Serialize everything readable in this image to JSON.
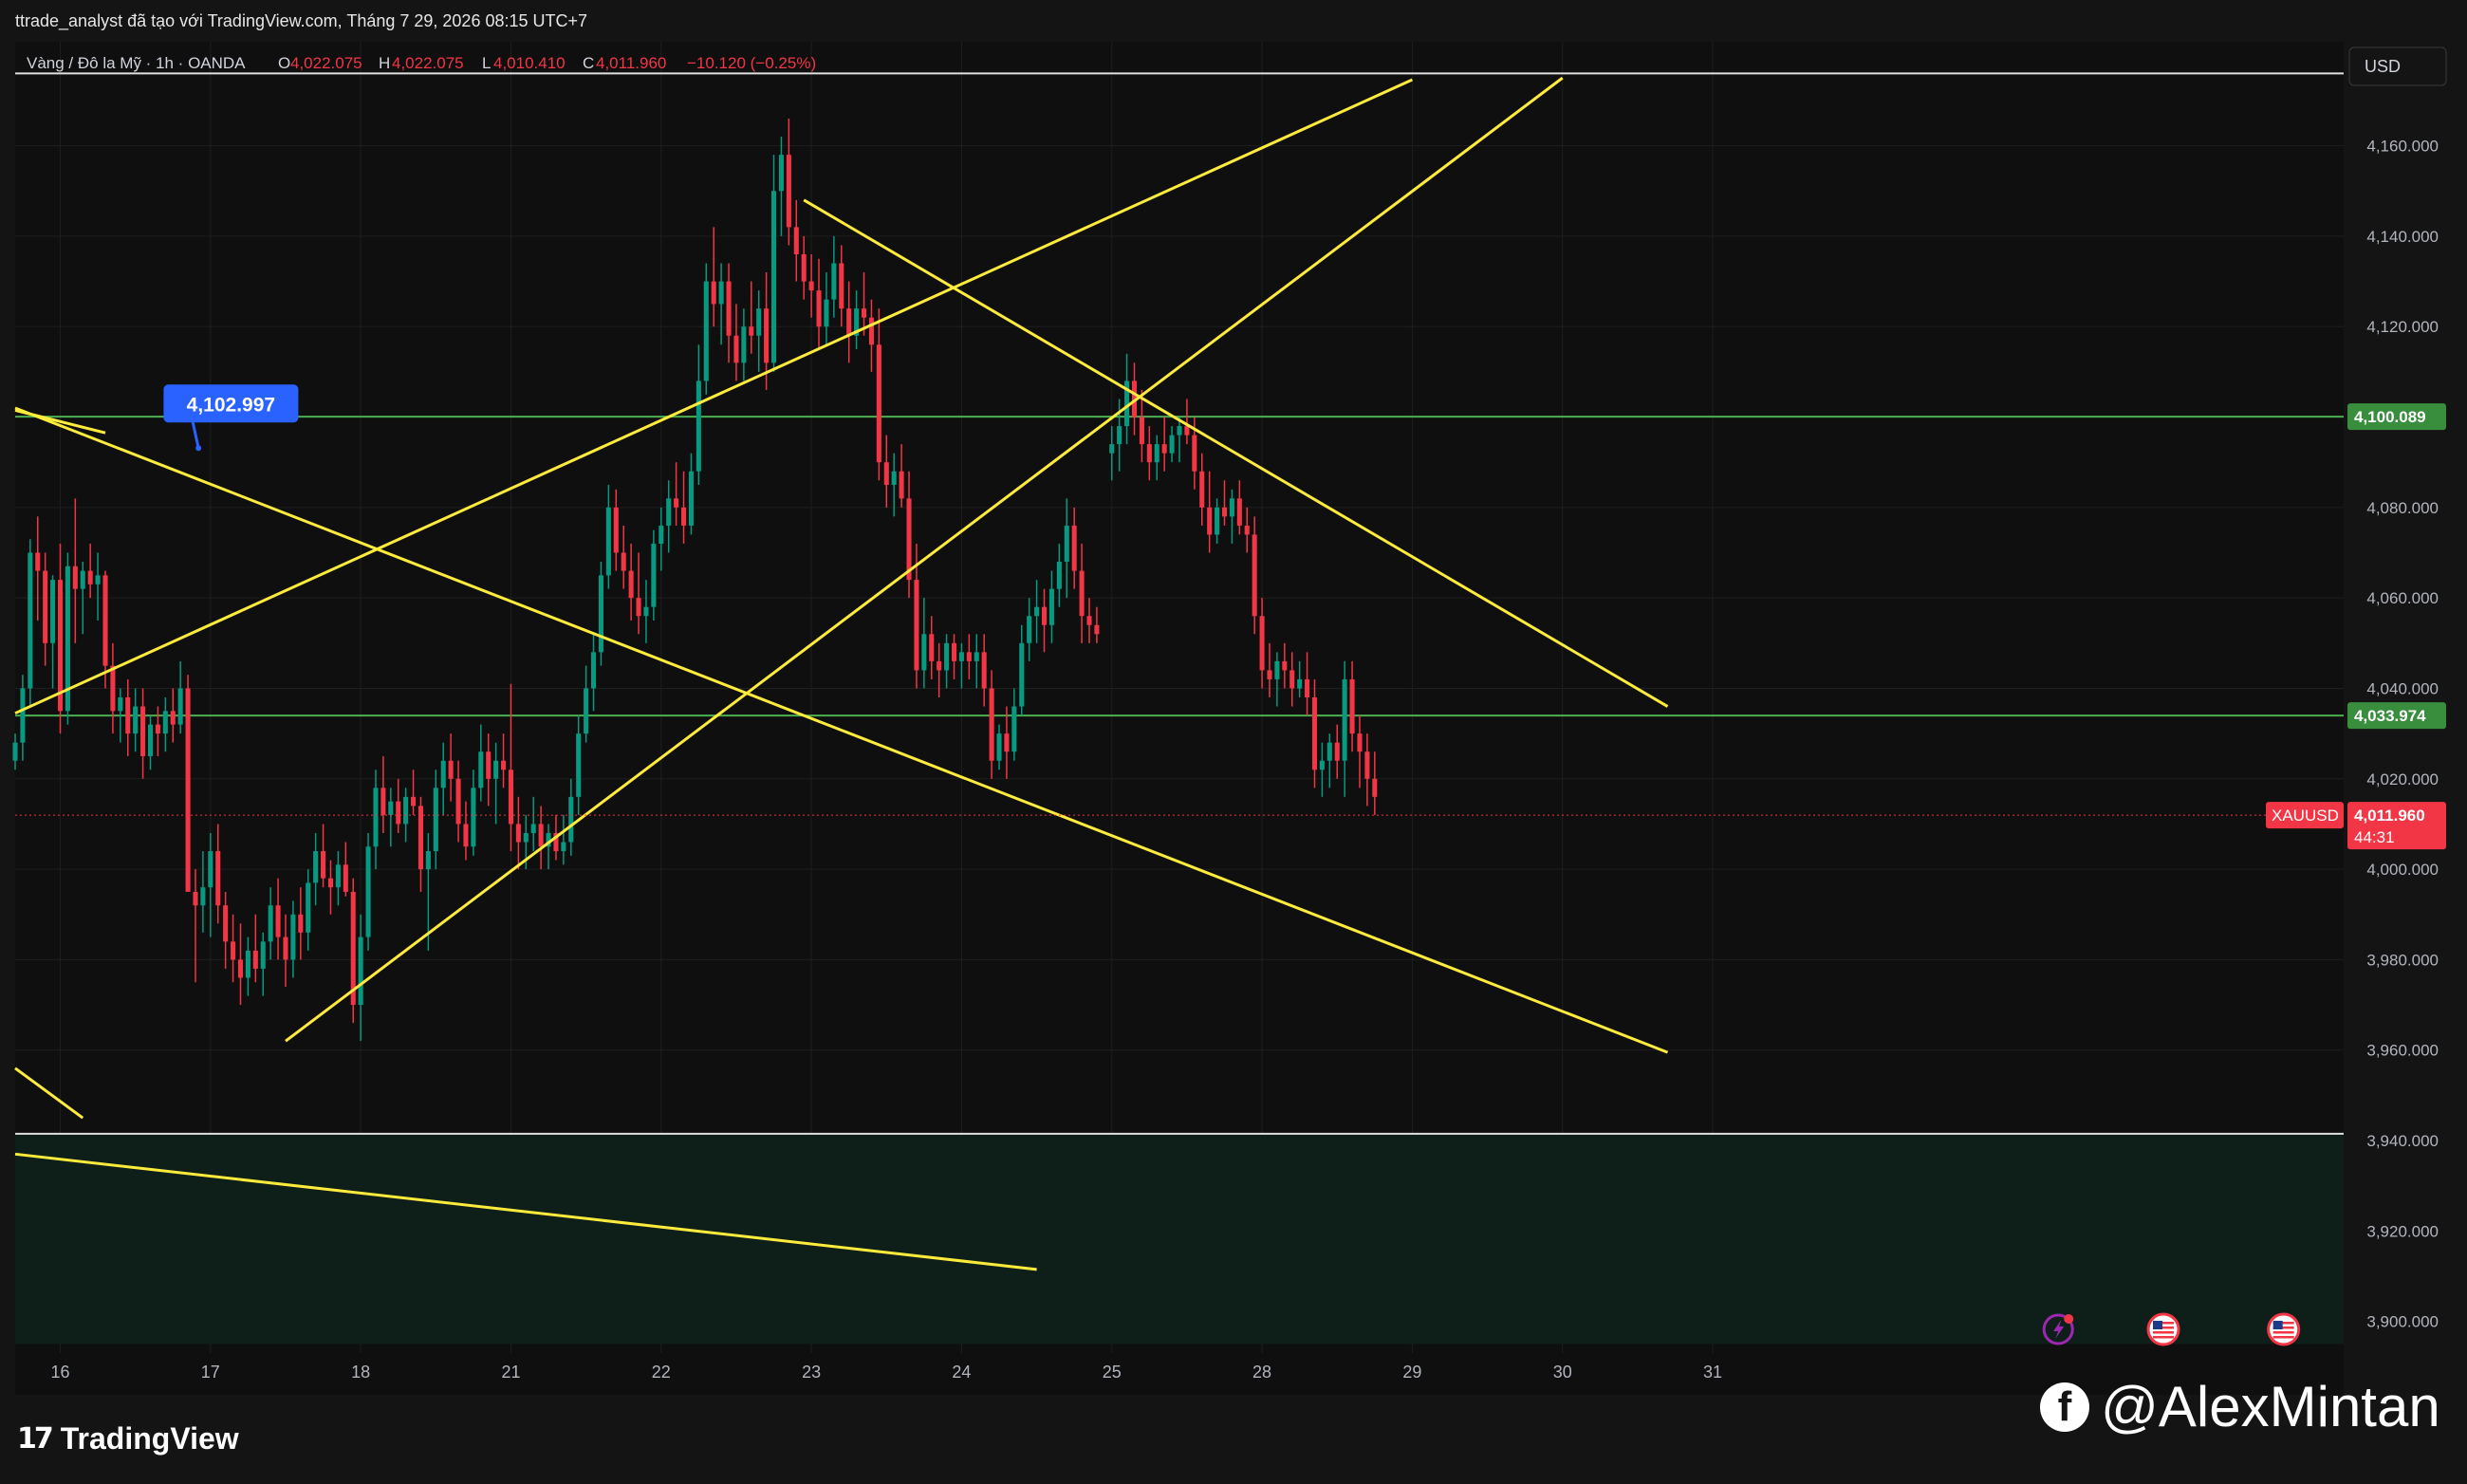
{
  "header": {
    "attribution": "ttrade_analyst đã tạo với TradingView.com, Tháng 7 29, 2026 08:15 UTC+7"
  },
  "legend": {
    "symbol": "Vàng / Đô la Mỹ · 1h · OANDA",
    "o_label": "O",
    "o_value": "4,022.075",
    "h_label": "H",
    "h_value": "4,022.075",
    "l_label": "L",
    "l_value": "4,010.410",
    "c_label": "C",
    "c_value": "4,011.960",
    "change": "−10.120 (−0.25%)"
  },
  "currency_label": "USD",
  "footer": {
    "brand": "TradingView"
  },
  "watermark": {
    "handle": "@AlexMintan"
  },
  "colors": {
    "background": "#0f0f0f",
    "up_candle": "#089981",
    "down_candle": "#f23645",
    "trendline": "#ffeb3b",
    "horizontal_level": "#4caf50",
    "callout": "#2962ff",
    "zone_fill": "#0e1f1a"
  },
  "callout": {
    "value": "4,102.997",
    "price": 4102.997
  },
  "price_badges": [
    {
      "price": 4100.089,
      "label": "4,100.089",
      "color": "#388e3c"
    },
    {
      "price": 4033.974,
      "label": "4,033.974",
      "color": "#388e3c"
    }
  ],
  "last_price": {
    "symbol": "XAUUSD",
    "price": 4011.96,
    "label": "4,011.960",
    "countdown": "44:31"
  },
  "horizontal_lines": [
    {
      "price": 4100.089,
      "color": "#4caf50"
    },
    {
      "price": 4033.974,
      "color": "#4caf50"
    },
    {
      "price": 4176.0,
      "color": "#e0e0e0"
    },
    {
      "price": 3941.5,
      "color": "#e0e0e0"
    }
  ],
  "zone": {
    "from_price": 3941.5,
    "to_price": 3895.0
  },
  "event_icons": [
    {
      "name": "lightning-event-icon",
      "x": 29.3
    },
    {
      "name": "us-flag-event-icon",
      "x": 30.0
    },
    {
      "name": "us-flag-event-icon",
      "x": 30.8
    }
  ],
  "chart_data": {
    "type": "candlestick",
    "title": "Vàng / Đô la Mỹ · 1h · OANDA",
    "x_axis": {
      "range": [
        15.7,
        31.2
      ],
      "ticks": [
        {
          "x": 16,
          "label": "16"
        },
        {
          "x": 17,
          "label": "17"
        },
        {
          "x": 18,
          "label": "18"
        },
        {
          "x": 19,
          "label": "21"
        },
        {
          "x": 20,
          "label": "22"
        },
        {
          "x": 21,
          "label": "23"
        },
        {
          "x": 22,
          "label": "24"
        },
        {
          "x": 23,
          "label": "25"
        },
        {
          "x": 24,
          "label": "28"
        },
        {
          "x": 25,
          "label": "29"
        },
        {
          "x": 26,
          "label": "30"
        },
        {
          "x": 27,
          "label": "31"
        }
      ]
    },
    "y_axis": {
      "range": [
        3893,
        4183
      ],
      "ticks": [
        3900,
        3920,
        3940,
        3960,
        3980,
        4000,
        4020,
        4040,
        4060,
        4080,
        4100,
        4120,
        4140,
        4160
      ],
      "tick_labels": [
        "3,900.000",
        "3,920.000",
        "3,940.000",
        "3,960.000",
        "3,980.000",
        "4,000.000",
        "4,020.000",
        "4,040.000",
        "4,060.000",
        "4,080.000",
        "4,100.000",
        "4,120.000",
        "4,140.000",
        "4,160.000"
      ]
    },
    "grid": true,
    "candles": [
      [
        15.7,
        4024,
        4030,
        4022,
        4028
      ],
      [
        15.75,
        4028,
        4043,
        4024,
        4040
      ],
      [
        15.8,
        4040,
        4073,
        4036,
        4070
      ],
      [
        15.85,
        4070,
        4078,
        4055,
        4066
      ],
      [
        15.9,
        4066,
        4070,
        4045,
        4050
      ],
      [
        15.95,
        4050,
        4065,
        4040,
        4064
      ],
      [
        16.0,
        4064,
        4072,
        4030,
        4035
      ],
      [
        16.05,
        4035,
        4070,
        4032,
        4067
      ],
      [
        16.1,
        4067,
        4082,
        4050,
        4062
      ],
      [
        16.15,
        4062,
        4068,
        4052,
        4066
      ],
      [
        16.2,
        4066,
        4072,
        4060,
        4063
      ],
      [
        16.25,
        4063,
        4070,
        4055,
        4065
      ],
      [
        16.3,
        4065,
        4066,
        4040,
        4045
      ],
      [
        16.35,
        4045,
        4050,
        4030,
        4035
      ],
      [
        16.4,
        4035,
        4040,
        4028,
        4038
      ],
      [
        16.45,
        4038,
        4042,
        4025,
        4030
      ],
      [
        16.5,
        4030,
        4040,
        4026,
        4036
      ],
      [
        16.55,
        4036,
        4040,
        4020,
        4025
      ],
      [
        16.6,
        4025,
        4034,
        4022,
        4032
      ],
      [
        16.65,
        4032,
        4036,
        4025,
        4030
      ],
      [
        16.7,
        4030,
        4038,
        4026,
        4035
      ],
      [
        16.75,
        4035,
        4040,
        4028,
        4032
      ],
      [
        16.8,
        4032,
        4046,
        4030,
        4040
      ],
      [
        16.85,
        4040,
        4043,
        4000,
        3995
      ],
      [
        16.9,
        3995,
        4000,
        3975,
        3992
      ],
      [
        16.95,
        3992,
        4004,
        3986,
        3996
      ],
      [
        17.0,
        3996,
        4008,
        3985,
        4004
      ],
      [
        17.05,
        4004,
        4010,
        3988,
        3992
      ],
      [
        17.1,
        3992,
        3995,
        3978,
        3984
      ],
      [
        17.15,
        3984,
        3990,
        3975,
        3980
      ],
      [
        17.2,
        3980,
        3988,
        3970,
        3976
      ],
      [
        17.25,
        3976,
        3985,
        3972,
        3982
      ],
      [
        17.3,
        3982,
        3990,
        3975,
        3978
      ],
      [
        17.35,
        3978,
        3986,
        3972,
        3984
      ],
      [
        17.4,
        3984,
        3996,
        3980,
        3992
      ],
      [
        17.45,
        3992,
        3998,
        3980,
        3985
      ],
      [
        17.5,
        3985,
        3990,
        3974,
        3980
      ],
      [
        17.55,
        3980,
        3993,
        3976,
        3990
      ],
      [
        17.6,
        3990,
        3996,
        3980,
        3986
      ],
      [
        17.65,
        3986,
        4000,
        3982,
        3997
      ],
      [
        17.7,
        3997,
        4008,
        3992,
        4004
      ],
      [
        17.75,
        4004,
        4010,
        3996,
        3998
      ],
      [
        17.8,
        3998,
        4002,
        3990,
        3996
      ],
      [
        17.85,
        3996,
        4004,
        3992,
        4001
      ],
      [
        17.9,
        4001,
        4006,
        3994,
        3995
      ],
      [
        17.95,
        3995,
        3998,
        3966,
        3970
      ],
      [
        18.0,
        3970,
        3990,
        3962,
        3985
      ],
      [
        18.05,
        3985,
        4008,
        3982,
        4005
      ],
      [
        18.1,
        4005,
        4022,
        4000,
        4018
      ],
      [
        18.15,
        4018,
        4025,
        4008,
        4012
      ],
      [
        18.2,
        4012,
        4018,
        4005,
        4015
      ],
      [
        18.25,
        4015,
        4020,
        4008,
        4010
      ],
      [
        18.3,
        4010,
        4018,
        4006,
        4016
      ],
      [
        18.35,
        4016,
        4022,
        4012,
        4014
      ],
      [
        18.4,
        4014,
        4016,
        3995,
        4000
      ],
      [
        18.45,
        4000,
        4008,
        3982,
        4004
      ],
      [
        18.5,
        4004,
        4022,
        4000,
        4018
      ],
      [
        18.55,
        4018,
        4028,
        4012,
        4024
      ],
      [
        18.6,
        4024,
        4030,
        4015,
        4020
      ],
      [
        18.65,
        4020,
        4024,
        4006,
        4010
      ],
      [
        18.7,
        4010,
        4015,
        4002,
        4005
      ],
      [
        18.75,
        4005,
        4022,
        4003,
        4018
      ],
      [
        18.8,
        4018,
        4032,
        4015,
        4026
      ],
      [
        18.85,
        4026,
        4030,
        4014,
        4020
      ],
      [
        18.9,
        4020,
        4028,
        4010,
        4024
      ],
      [
        18.95,
        4024,
        4030,
        4018,
        4022
      ],
      [
        19.0,
        4022,
        4041,
        4004,
        4010
      ],
      [
        19.05,
        4010,
        4016,
        4000,
        4006
      ],
      [
        19.1,
        4006,
        4012,
        4000,
        4008
      ],
      [
        19.15,
        4008,
        4016,
        4004,
        4010
      ],
      [
        19.2,
        4010,
        4014,
        4000,
        4005
      ],
      [
        19.25,
        4005,
        4010,
        4000,
        4008
      ],
      [
        19.3,
        4008,
        4012,
        4002,
        4004
      ],
      [
        19.35,
        4004,
        4012,
        4001,
        4006
      ],
      [
        19.4,
        4006,
        4020,
        4003,
        4016
      ],
      [
        19.45,
        4016,
        4034,
        4012,
        4030
      ],
      [
        19.5,
        4030,
        4045,
        4028,
        4040
      ],
      [
        19.55,
        4040,
        4052,
        4035,
        4048
      ],
      [
        19.6,
        4048,
        4068,
        4045,
        4065
      ],
      [
        19.65,
        4065,
        4085,
        4062,
        4080
      ],
      [
        19.7,
        4080,
        4084,
        4066,
        4070
      ],
      [
        19.75,
        4070,
        4076,
        4062,
        4066
      ],
      [
        19.8,
        4066,
        4072,
        4055,
        4060
      ],
      [
        19.85,
        4060,
        4070,
        4052,
        4056
      ],
      [
        19.9,
        4056,
        4064,
        4050,
        4058
      ],
      [
        19.95,
        4058,
        4075,
        4055,
        4072
      ],
      [
        20.0,
        4072,
        4080,
        4066,
        4076
      ],
      [
        20.05,
        4076,
        4086,
        4070,
        4082
      ],
      [
        20.1,
        4082,
        4090,
        4076,
        4080
      ],
      [
        20.15,
        4080,
        4088,
        4072,
        4076
      ],
      [
        20.2,
        4076,
        4092,
        4074,
        4088
      ],
      [
        20.25,
        4088,
        4116,
        4085,
        4108
      ],
      [
        20.3,
        4108,
        4134,
        4105,
        4130
      ],
      [
        20.35,
        4130,
        4142,
        4120,
        4125
      ],
      [
        20.4,
        4125,
        4134,
        4116,
        4130
      ],
      [
        20.45,
        4130,
        4134,
        4112,
        4118
      ],
      [
        20.5,
        4118,
        4125,
        4108,
        4112
      ],
      [
        20.55,
        4112,
        4124,
        4108,
        4120
      ],
      [
        20.6,
        4120,
        4130,
        4114,
        4118
      ],
      [
        20.65,
        4118,
        4128,
        4110,
        4124
      ],
      [
        20.7,
        4124,
        4132,
        4106,
        4112
      ],
      [
        20.75,
        4112,
        4158,
        4110,
        4150
      ],
      [
        20.8,
        4150,
        4162,
        4140,
        4158
      ],
      [
        20.85,
        4158,
        4166,
        4138,
        4142
      ],
      [
        20.9,
        4142,
        4148,
        4130,
        4136
      ],
      [
        20.95,
        4136,
        4140,
        4126,
        4130
      ],
      [
        21.0,
        4130,
        4136,
        4122,
        4128
      ],
      [
        21.05,
        4128,
        4135,
        4115,
        4120
      ],
      [
        21.1,
        4120,
        4132,
        4116,
        4126
      ],
      [
        21.15,
        4126,
        4140,
        4122,
        4134
      ],
      [
        21.2,
        4134,
        4138,
        4120,
        4124
      ],
      [
        21.25,
        4124,
        4130,
        4112,
        4118
      ],
      [
        21.3,
        4118,
        4128,
        4115,
        4124
      ],
      [
        21.35,
        4124,
        4132,
        4118,
        4122
      ],
      [
        21.4,
        4122,
        4126,
        4110,
        4116
      ],
      [
        21.45,
        4116,
        4124,
        4086,
        4090
      ],
      [
        21.5,
        4090,
        4096,
        4080,
        4085
      ],
      [
        21.55,
        4085,
        4092,
        4078,
        4088
      ],
      [
        21.6,
        4088,
        4094,
        4080,
        4082
      ],
      [
        21.65,
        4082,
        4088,
        4060,
        4064
      ],
      [
        21.7,
        4064,
        4072,
        4040,
        4044
      ],
      [
        21.75,
        4044,
        4060,
        4040,
        4052
      ],
      [
        21.8,
        4052,
        4056,
        4042,
        4046
      ],
      [
        21.85,
        4046,
        4050,
        4038,
        4044
      ],
      [
        21.9,
        4044,
        4052,
        4040,
        4050
      ],
      [
        21.95,
        4050,
        4052,
        4042,
        4046
      ],
      [
        22.0,
        4046,
        4050,
        4040,
        4048
      ],
      [
        22.05,
        4048,
        4052,
        4042,
        4046
      ],
      [
        22.1,
        4046,
        4052,
        4040,
        4048
      ],
      [
        22.15,
        4048,
        4052,
        4036,
        4040
      ],
      [
        22.2,
        4040,
        4044,
        4020,
        4024
      ],
      [
        22.25,
        4024,
        4032,
        4022,
        4030
      ],
      [
        22.3,
        4030,
        4036,
        4020,
        4026
      ],
      [
        22.35,
        4026,
        4040,
        4024,
        4036
      ],
      [
        22.4,
        4036,
        4054,
        4034,
        4050
      ],
      [
        22.45,
        4050,
        4060,
        4046,
        4056
      ],
      [
        22.5,
        4056,
        4064,
        4050,
        4058
      ],
      [
        22.55,
        4058,
        4062,
        4048,
        4054
      ],
      [
        22.6,
        4054,
        4066,
        4050,
        4062
      ],
      [
        22.65,
        4062,
        4072,
        4058,
        4068
      ],
      [
        22.7,
        4068,
        4082,
        4060,
        4076
      ],
      [
        22.75,
        4076,
        4080,
        4062,
        4066
      ],
      [
        22.8,
        4066,
        4072,
        4050,
        4056
      ],
      [
        22.85,
        4056,
        4060,
        4050,
        4054
      ],
      [
        22.9,
        4054,
        4058,
        4050,
        4052
      ],
      [
        23.0,
        4092,
        4098,
        4086,
        4094
      ],
      [
        23.05,
        4094,
        4104,
        4088,
        4098
      ],
      [
        23.1,
        4098,
        4114,
        4094,
        4108
      ],
      [
        23.15,
        4108,
        4112,
        4096,
        4100
      ],
      [
        23.2,
        4100,
        4106,
        4090,
        4094
      ],
      [
        23.25,
        4094,
        4098,
        4086,
        4090
      ],
      [
        23.3,
        4090,
        4096,
        4086,
        4094
      ],
      [
        23.35,
        4094,
        4100,
        4088,
        4092
      ],
      [
        23.4,
        4092,
        4098,
        4090,
        4096
      ],
      [
        23.45,
        4096,
        4100,
        4090,
        4098
      ],
      [
        23.5,
        4098,
        4104,
        4094,
        4096
      ],
      [
        23.55,
        4096,
        4100,
        4084,
        4088
      ],
      [
        23.6,
        4088,
        4092,
        4076,
        4080
      ],
      [
        23.65,
        4080,
        4088,
        4070,
        4074
      ],
      [
        23.7,
        4074,
        4082,
        4072,
        4080
      ],
      [
        23.75,
        4080,
        4086,
        4076,
        4078
      ],
      [
        23.8,
        4078,
        4084,
        4072,
        4082
      ],
      [
        23.85,
        4082,
        4086,
        4074,
        4076
      ],
      [
        23.9,
        4076,
        4080,
        4070,
        4074
      ],
      [
        23.95,
        4074,
        4078,
        4052,
        4056
      ],
      [
        24.0,
        4056,
        4060,
        4040,
        4044
      ],
      [
        24.05,
        4044,
        4050,
        4038,
        4042
      ],
      [
        24.1,
        4042,
        4048,
        4036,
        4046
      ],
      [
        24.15,
        4046,
        4050,
        4040,
        4044
      ],
      [
        24.2,
        4044,
        4048,
        4036,
        4040
      ],
      [
        24.25,
        4040,
        4046,
        4038,
        4042
      ],
      [
        24.3,
        4042,
        4048,
        4034,
        4038
      ],
      [
        24.35,
        4038,
        4042,
        4018,
        4022
      ],
      [
        24.4,
        4022,
        4028,
        4016,
        4024
      ],
      [
        24.45,
        4024,
        4030,
        4018,
        4028
      ],
      [
        24.5,
        4028,
        4032,
        4020,
        4024
      ],
      [
        24.55,
        4024,
        4046,
        4016,
        4042
      ],
      [
        24.6,
        4042,
        4046,
        4026,
        4030
      ],
      [
        24.65,
        4030,
        4034,
        4018,
        4026
      ],
      [
        24.7,
        4026,
        4030,
        4014,
        4020
      ],
      [
        24.75,
        4020,
        4026,
        4012,
        4016
      ]
    ],
    "trendlines": [
      {
        "x1": 15.7,
        "y1": 4034.5,
        "x2": 25.0,
        "y2": 4174.6
      },
      {
        "x1": 15.7,
        "y1": 4102.0,
        "x2": 26.7,
        "y2": 3959.5
      },
      {
        "x1": 15.7,
        "y1": 4101.5,
        "x2": 16.3,
        "y2": 4096.5
      },
      {
        "x1": 17.5,
        "y1": 3962.0,
        "x2": 26.0,
        "y2": 4175.0
      },
      {
        "x1": 20.95,
        "y1": 4148.0,
        "x2": 26.7,
        "y2": 4036.0
      },
      {
        "x1": 15.7,
        "y1": 3956.0,
        "x2": 16.15,
        "y2": 3945.0
      },
      {
        "x1": 15.7,
        "y1": 3937.0,
        "x2": 22.5,
        "y2": 3911.5
      }
    ]
  }
}
